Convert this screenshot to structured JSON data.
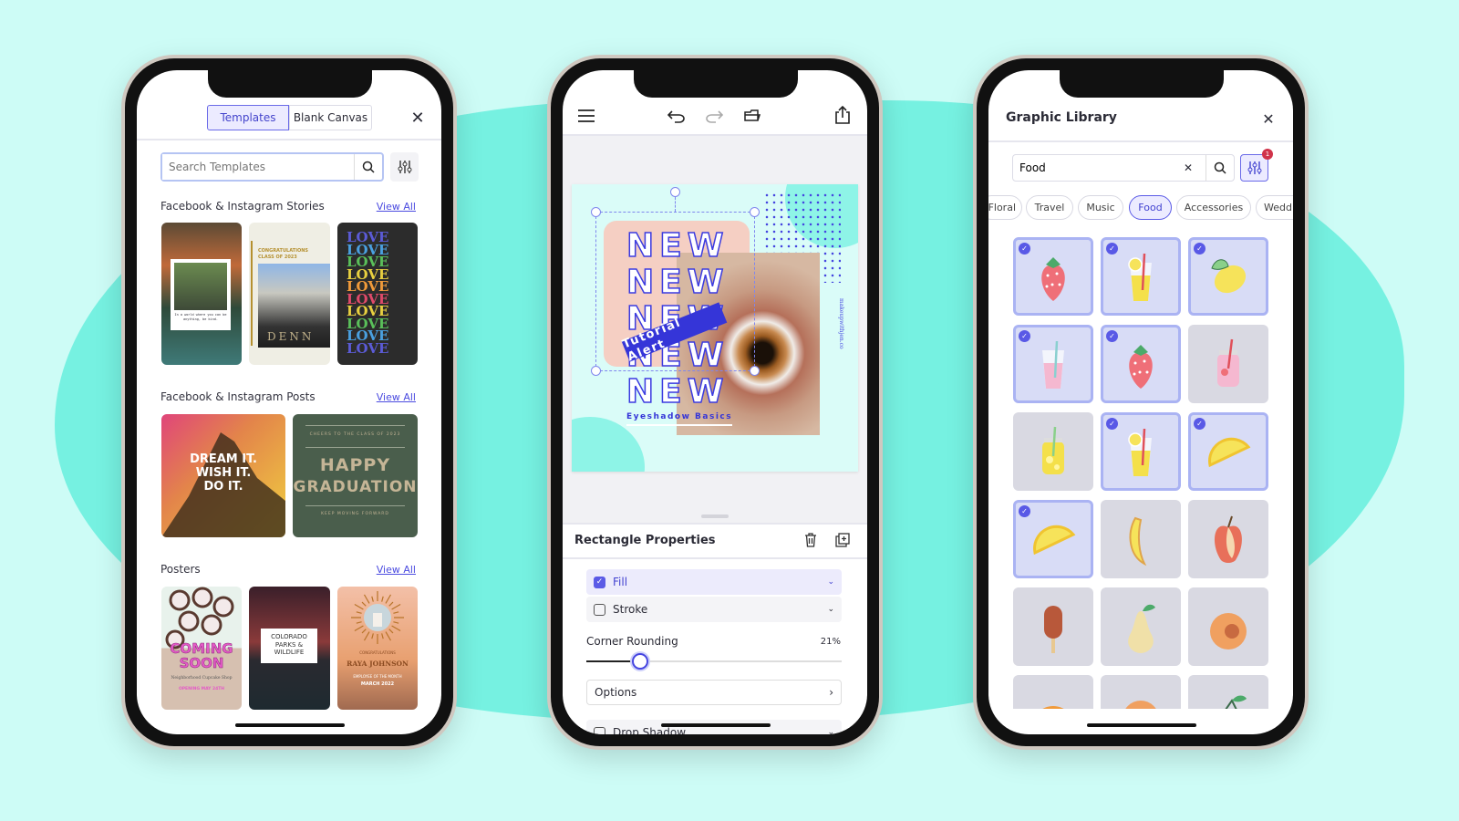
{
  "colors": {
    "accent": "#4b4be0",
    "background": "#cdfcf6",
    "blob": "#76f1e1",
    "badge": "#d0334a"
  },
  "left": {
    "tabs": [
      {
        "label": "Templates",
        "active": true
      },
      {
        "label": "Blank Canvas",
        "active": false
      }
    ],
    "search_placeholder": "Search Templates",
    "sections": [
      {
        "title": "Facebook & Instagram Stories",
        "view_all": "View All",
        "items": [
          {
            "name": "forest-quote",
            "text": "In a world where you can be anything, be kind."
          },
          {
            "name": "congrats-grad",
            "text": "CONGRATULATIONS CLASS OF 2023",
            "sub": "DENN"
          },
          {
            "name": "love-is-love",
            "text": "LOVE",
            "accent": "is"
          }
        ]
      },
      {
        "title": "Facebook & Instagram Posts",
        "view_all": "View All",
        "items": [
          {
            "name": "dream-it",
            "lines": [
              "DREAM IT.",
              "WISH IT.",
              "DO IT."
            ]
          },
          {
            "name": "happy-graduation",
            "top": "CHEERS TO THE CLASS OF 2023",
            "lines": [
              "HAPPY",
              "GRADUATION"
            ],
            "bottom": "KEEP MOVING FORWARD"
          }
        ]
      },
      {
        "title": "Posters",
        "view_all": "View All",
        "items": [
          {
            "name": "coming-soon",
            "lines": [
              "COMING",
              "SOON"
            ],
            "sub": "Neighborhood Cupcake Shop",
            "date": "OPENING MAY 24TH"
          },
          {
            "name": "colorado-parks",
            "lines": [
              "COLORADO",
              "PARKS &",
              "WILDLIFE"
            ]
          },
          {
            "name": "raya-johnson",
            "top": "CONGRATULATIONS",
            "title": "RAYA JOHNSON",
            "sub": "EMPLOYEE OF THE MONTH",
            "date": "MARCH 2022"
          }
        ]
      }
    ]
  },
  "middle": {
    "toolbar": [
      "menu-icon",
      "undo-icon",
      "redo-icon",
      "layers-icon",
      "share-icon"
    ],
    "design": {
      "headline": "NEW",
      "banner": "Tutorial Alert",
      "subtitle": "Eyeshadow Basics",
      "handle": "makeupwithjen.co"
    },
    "panel": {
      "title": "Rectangle Properties",
      "fill": {
        "label": "Fill",
        "checked": true
      },
      "stroke": {
        "label": "Stroke",
        "checked": false
      },
      "corner_label": "Corner Rounding",
      "corner_value": "21%",
      "corner_percent": 21,
      "options": "Options",
      "drop_shadow": {
        "label": "Drop Shadow",
        "checked": false
      }
    }
  },
  "right": {
    "title": "Graphic Library",
    "search_value": "Food",
    "filter_badge": "1",
    "chips": [
      {
        "label": "Floral"
      },
      {
        "label": "Travel"
      },
      {
        "label": "Music"
      },
      {
        "label": "Food",
        "active": true
      },
      {
        "label": "Accessories"
      },
      {
        "label": "Wedd"
      }
    ],
    "graphics": [
      {
        "icon": "strawberry",
        "selected": true
      },
      {
        "icon": "lemonade-glass",
        "selected": true
      },
      {
        "icon": "lemon",
        "selected": true
      },
      {
        "icon": "pink-drink",
        "selected": true
      },
      {
        "icon": "strawberry",
        "selected": true
      },
      {
        "icon": "pink-jar",
        "selected": false
      },
      {
        "icon": "lemonade-jar",
        "selected": false
      },
      {
        "icon": "lemonade-glass",
        "selected": true
      },
      {
        "icon": "lemon-slice",
        "selected": true
      },
      {
        "icon": "lemon-slice",
        "selected": true
      },
      {
        "icon": "banana",
        "selected": false
      },
      {
        "icon": "apple",
        "selected": false
      },
      {
        "icon": "popsicle",
        "selected": false
      },
      {
        "icon": "pear",
        "selected": false
      },
      {
        "icon": "peach",
        "selected": false
      },
      {
        "icon": "orange",
        "selected": false
      },
      {
        "icon": "peach",
        "selected": false
      },
      {
        "icon": "cherry",
        "selected": false
      }
    ]
  }
}
